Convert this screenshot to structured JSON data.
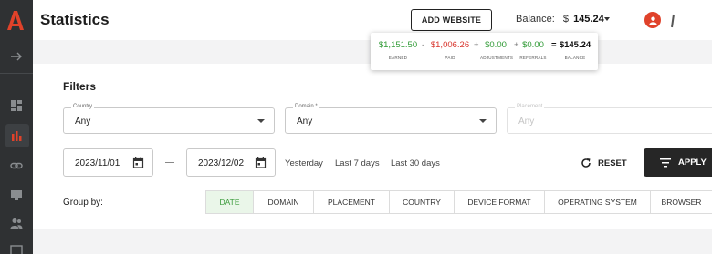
{
  "header": {
    "title": "Statistics",
    "add_website_label": "ADD WEBSITE",
    "balance_label": "Balance:",
    "balance_currency": "$",
    "balance_amount": "145.24"
  },
  "balance_popover": {
    "earned": {
      "value": "$1,151.50",
      "label": "EARNED"
    },
    "op1": "-",
    "paid": {
      "value": "$1,006.26",
      "label": "PAID"
    },
    "op2": "+",
    "adjustments": {
      "value": "$0.00",
      "label": "ADJUSTMENTS"
    },
    "op3": "+",
    "referrals": {
      "value": "$0.00",
      "label": "REFERRALS"
    },
    "op4": "=",
    "balance": {
      "value": "$145.24",
      "label": "BALANCE"
    }
  },
  "filters": {
    "title": "Filters",
    "country": {
      "label": "Country",
      "value": "Any"
    },
    "domain": {
      "label": "Domain *",
      "value": "Any"
    },
    "placement": {
      "label": "Placement",
      "value": "Any"
    },
    "date_from": "2023/11/01",
    "date_to": "2023/12/02",
    "quick_ranges": [
      "Yesterday",
      "Last 7 days",
      "Last 30 days"
    ],
    "reset_label": "RESET",
    "apply_label": "APPLY"
  },
  "group_by": {
    "label": "Group by:",
    "tabs": [
      "DATE",
      "DOMAIN",
      "PLACEMENT",
      "COUNTRY",
      "DEVICE FORMAT",
      "OPERATING SYSTEM",
      "BROWSER"
    ],
    "active": "DATE"
  },
  "colors": {
    "brand": "#e0422a",
    "sidebar": "#2f3133",
    "earned": "#2f9a35",
    "paid": "#d8352d",
    "active_tab_bg": "#eaf6e9"
  },
  "icons": {
    "sidebar": [
      "collapse-arrow-icon",
      "dashboard-icon",
      "statistics-icon",
      "link-icon",
      "monitor-icon",
      "users-icon",
      "screen-icon"
    ]
  }
}
